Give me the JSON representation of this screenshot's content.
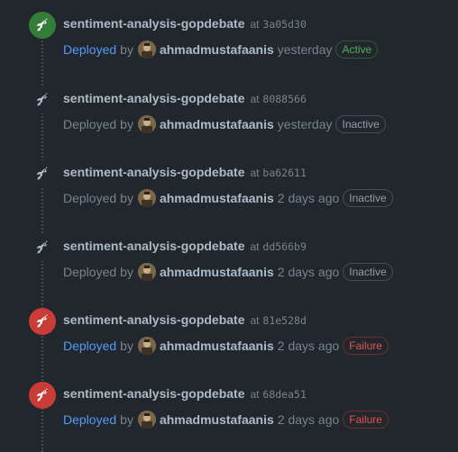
{
  "deployments": [
    {
      "environment": "sentiment-analysis-gopdebate",
      "at_label": "at",
      "sha": "3a05d30",
      "deployed_label": "Deployed",
      "by_label": "by",
      "user": "ahmadmustafaanis",
      "time": "yesterday",
      "status": "Active",
      "state": "success",
      "icon": "rocket-icon"
    },
    {
      "environment": "sentiment-analysis-gopdebate",
      "at_label": "at",
      "sha": "8088566",
      "deployed_label": "Deployed",
      "by_label": "by",
      "user": "ahmadmustafaanis",
      "time": "yesterday",
      "status": "Inactive",
      "state": "inactive",
      "icon": "rocket-icon"
    },
    {
      "environment": "sentiment-analysis-gopdebate",
      "at_label": "at",
      "sha": "ba62611",
      "deployed_label": "Deployed",
      "by_label": "by",
      "user": "ahmadmustafaanis",
      "time": "2 days ago",
      "status": "Inactive",
      "state": "inactive",
      "icon": "rocket-icon"
    },
    {
      "environment": "sentiment-analysis-gopdebate",
      "at_label": "at",
      "sha": "dd566b9",
      "deployed_label": "Deployed",
      "by_label": "by",
      "user": "ahmadmustafaanis",
      "time": "2 days ago",
      "status": "Inactive",
      "state": "inactive",
      "icon": "rocket-icon"
    },
    {
      "environment": "sentiment-analysis-gopdebate",
      "at_label": "at",
      "sha": "81e528d",
      "deployed_label": "Deployed",
      "by_label": "by",
      "user": "ahmadmustafaanis",
      "time": "2 days ago",
      "status": "Failure",
      "state": "failure",
      "icon": "rocket-icon"
    },
    {
      "environment": "sentiment-analysis-gopdebate",
      "at_label": "at",
      "sha": "68dea51",
      "deployed_label": "Deployed",
      "by_label": "by",
      "user": "ahmadmustafaanis",
      "time": "2 days ago",
      "status": "Failure",
      "state": "failure",
      "icon": "rocket-icon"
    }
  ],
  "colors": {
    "background": "#22272e",
    "success": "#347d39",
    "failure": "#c93c37",
    "link": "#539bf5",
    "muted": "#768390",
    "text": "#adbac7"
  }
}
